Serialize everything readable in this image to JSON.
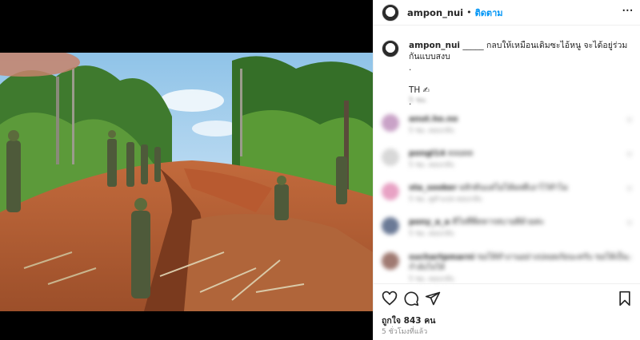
{
  "post": {
    "username": "ampon_nui",
    "separator": "•",
    "follow_label": "ติดตาม",
    "more_label": "···"
  },
  "caption": {
    "username": "ampon_nui",
    "text": "_____ กลบให้เหมือนเดิมซะไอ้หนู จะได้อยู่ร่วมกันแบบสงบ",
    "line2": ".",
    "line3": "TH",
    "line4": ".",
    "time": "5 ชม."
  },
  "comments": [
    {
      "user": "anut.ho.no",
      "text": "",
      "meta": "5 ชม.   ตอบกลับ",
      "avatar_color": "#c9a2c7"
    },
    {
      "user": "pongl14",
      "text": "ตลอดด",
      "meta": "5 ชม.   ตอบกลับ",
      "avatar_color": "#d8d8d8"
    },
    {
      "user": "sta_sooker",
      "text": "ผลักดันแต่ไม่ได้ผลดีเอาไว้ทำไม",
      "meta": "5 ชม.   ดูคำแปล   ตอบกลับ",
      "avatar_color": "#e8a2c4"
    },
    {
      "user": "pony_a_a",
      "text": "ดีใจที่พี่ทหารสบายดีด้วยค่ะ",
      "meta": "5 ชม.   ตอบกลับ",
      "avatar_color": "#6b7a96"
    },
    {
      "user": "suchartpmarni",
      "text": "ขอให้ทำงานอย่างปลอดภัยนะครับ ขอให้เป็นกำลังใจให้",
      "meta": "5 ชม.   ตอบกลับ",
      "avatar_color": "#a07a72"
    }
  ],
  "stats": {
    "likes": "ถูกใจ 843 คน",
    "time_ago": "5 ชั่วโมงที่แล้ว"
  },
  "icons": [
    "heart-icon",
    "comment-icon",
    "share-icon",
    "bookmark-icon",
    "more-icon"
  ],
  "colors": {
    "accent": "#0095f6",
    "text": "#262626",
    "muted": "#8e8e8e",
    "border": "#efefef"
  }
}
